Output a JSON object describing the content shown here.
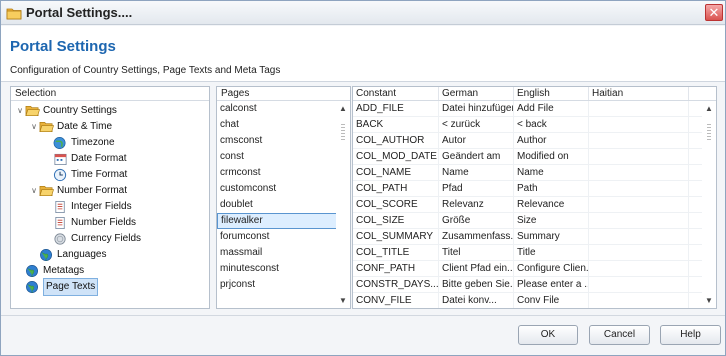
{
  "window": {
    "title": "Portal Settings...."
  },
  "header": {
    "title": "Portal Settings",
    "subtitle": "Configuration of Country Settings, Page Texts and Meta Tags"
  },
  "selection": {
    "header": "Selection",
    "tree": [
      {
        "label": "Country Settings",
        "icon": "folder-open-icon",
        "level": 0,
        "expanded": true
      },
      {
        "label": "Date & Time",
        "icon": "folder-open-icon",
        "level": 1,
        "expanded": true
      },
      {
        "label": "Timezone",
        "icon": "globe-clock-icon",
        "level": 2
      },
      {
        "label": "Date Format",
        "icon": "calendar-icon",
        "level": 2
      },
      {
        "label": "Time Format",
        "icon": "clock-icon",
        "level": 2
      },
      {
        "label": "Number Format",
        "icon": "folder-open-icon",
        "level": 1,
        "expanded": true
      },
      {
        "label": "Integer Fields",
        "icon": "document-icon",
        "level": 2
      },
      {
        "label": "Number Fields",
        "icon": "document-icon",
        "level": 2
      },
      {
        "label": "Currency Fields",
        "icon": "coin-icon",
        "level": 2
      },
      {
        "label": "Languages",
        "icon": "globe-icon",
        "level": 1
      },
      {
        "label": "Metatags",
        "icon": "globe-icon",
        "level": 0
      },
      {
        "label": "Page Texts",
        "icon": "globe-icon",
        "level": 0,
        "selected": true
      }
    ]
  },
  "pages": {
    "header": "Pages",
    "items": [
      "calconst",
      "chat",
      "cmsconst",
      "const",
      "crmconst",
      "customconst",
      "doublet",
      "filewalker",
      "forumconst",
      "massmail",
      "minutesconst",
      "prjconst"
    ],
    "selected_index": 7
  },
  "grid": {
    "columns": [
      "Constant",
      "German",
      "English",
      "Haitian"
    ],
    "rows": [
      [
        "ADD_FILE",
        "Datei hinzufügen",
        "Add File",
        ""
      ],
      [
        "BACK",
        "< zurück",
        "< back",
        ""
      ],
      [
        "COL_AUTHOR",
        "Autor",
        "Author",
        ""
      ],
      [
        "COL_MOD_DATE",
        "Geändert am",
        "Modified on",
        ""
      ],
      [
        "COL_NAME",
        "Name",
        "Name",
        ""
      ],
      [
        "COL_PATH",
        "Pfad",
        "Path",
        ""
      ],
      [
        "COL_SCORE",
        "Relevanz",
        "Relevance",
        ""
      ],
      [
        "COL_SIZE",
        "Größe",
        "Size",
        ""
      ],
      [
        "COL_SUMMARY",
        "Zusammenfass...",
        "Summary",
        ""
      ],
      [
        "COL_TITLE",
        "Titel",
        "Title",
        ""
      ],
      [
        "CONF_PATH",
        "Client Pfad ein...",
        "Configure Clien...",
        ""
      ],
      [
        "CONSTR_DAYS...",
        "Bitte geben Sie...",
        "Please enter a ...",
        ""
      ],
      [
        "CONV_FILE",
        "Datei konv...",
        "Conv File",
        ""
      ]
    ]
  },
  "buttons": {
    "ok": "OK",
    "cancel": "Cancel",
    "help": "Help"
  },
  "colors": {
    "accent": "#1d66b0",
    "selection": "#cfe3f8",
    "border": "#b6c0cc"
  }
}
